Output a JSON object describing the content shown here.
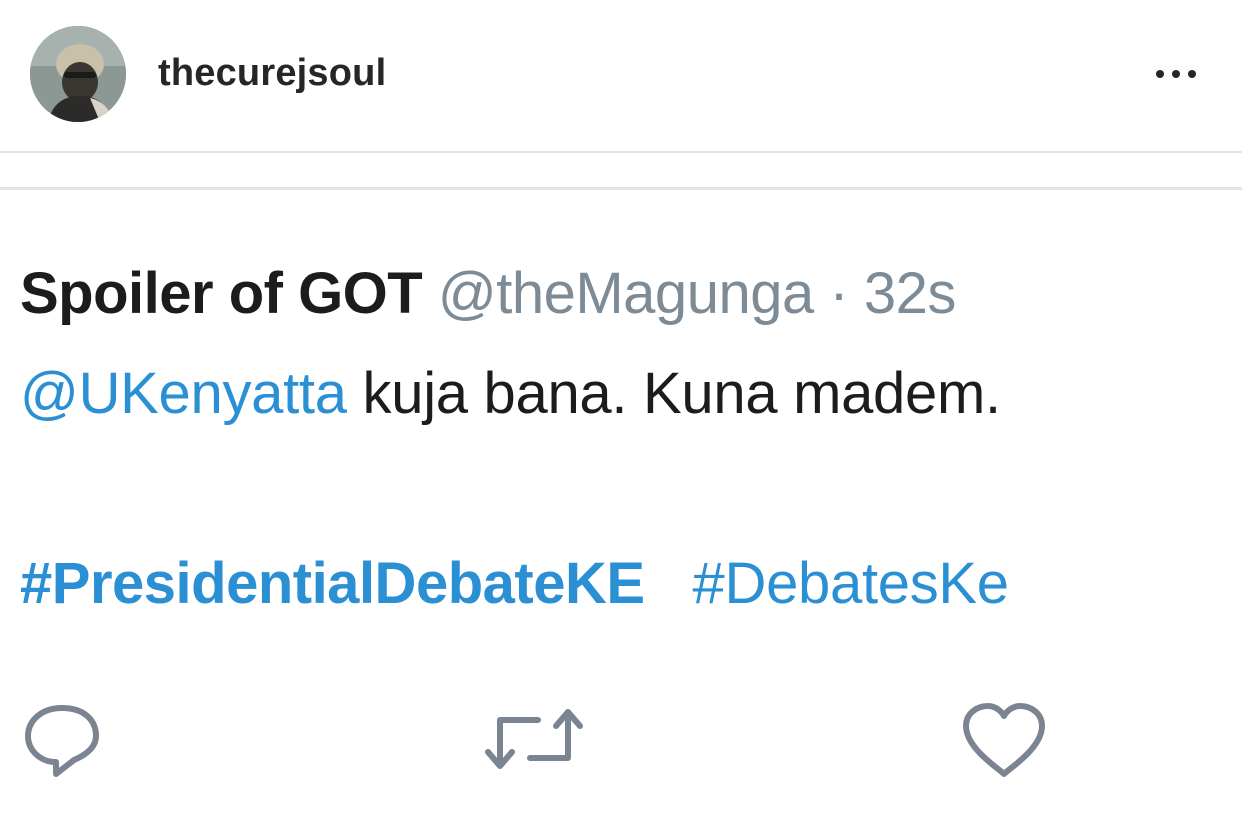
{
  "post": {
    "username": "thecurejsoul",
    "avatar_icon": "user-avatar-photo",
    "more_icon": "more-horizontal-icon"
  },
  "tweet": {
    "display_name": "Spoiler of GOT",
    "handle": "@theMagunga",
    "separator": "·",
    "time": "32s",
    "mention": "@UKenyatta",
    "text": "kuja bana. Kuna madem.",
    "hashtags": [
      "#PresidentialDebateKE",
      "#DebatesKe"
    ],
    "actions": {
      "reply_icon": "reply-icon",
      "retweet_icon": "retweet-icon",
      "like_icon": "heart-icon"
    }
  },
  "colors": {
    "link": "#2b8fd3",
    "muted": "#7d8b97",
    "text": "#1c1c1c",
    "divider": "#e2e3eb"
  }
}
